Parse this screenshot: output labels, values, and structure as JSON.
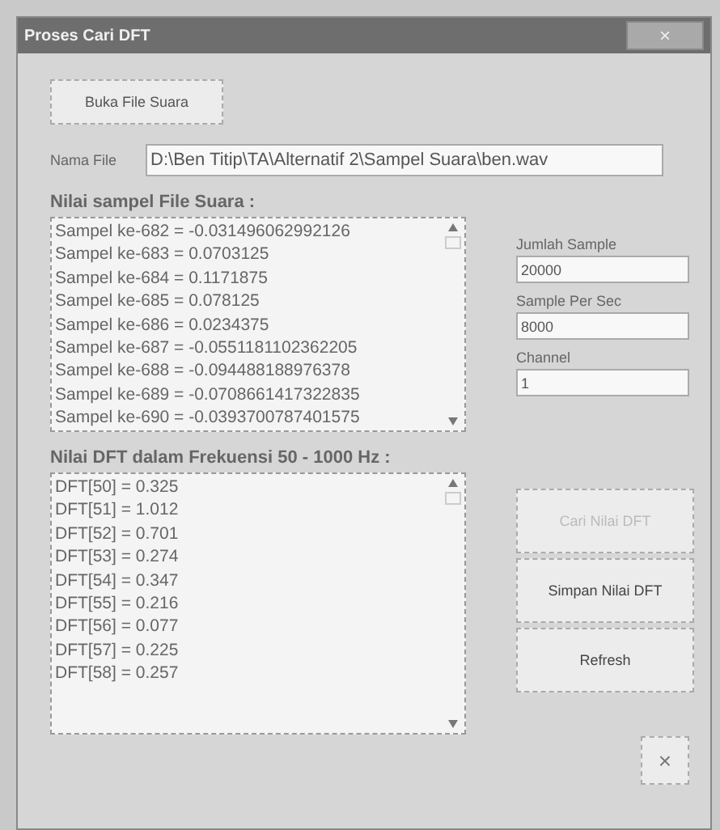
{
  "window": {
    "title": "Proses Cari DFT",
    "close": "×"
  },
  "open_button": {
    "label": "Buka File Suara"
  },
  "file_name": {
    "label": "Nama File",
    "value": "D:\\Ben Titip\\TA\\Alternatif 2\\Sampel Suara\\ben.wav"
  },
  "samples": {
    "heading": "Nilai sampel File Suara :",
    "items": [
      "Sampel ke-682 = -0.031496062992126",
      "Sampel ke-683 = 0.0703125",
      "Sampel ke-684 = 0.1171875",
      "Sampel ke-685 = 0.078125",
      "Sampel ke-686 = 0.0234375",
      "Sampel ke-687 = -0.0551181102362205",
      "Sampel ke-688 = -0.094488188976378",
      "Sampel ke-689 = -0.0708661417322835",
      "Sampel ke-690 = -0.0393700787401575"
    ]
  },
  "info_fields": [
    {
      "label": "Jumlah Sample",
      "value": "20000"
    },
    {
      "label": "Sample Per Sec",
      "value": "8000"
    },
    {
      "label": "Channel",
      "value": "1"
    }
  ],
  "dft": {
    "heading": "Nilai DFT dalam Frekuensi 50 - 1000 Hz :",
    "items": [
      "DFT[50] = 0.325",
      "DFT[51] = 1.012",
      "DFT[52] = 0.701",
      "DFT[53] = 0.274",
      "DFT[54] = 0.347",
      "DFT[55] = 0.216",
      "DFT[56] = 0.077",
      "DFT[57] = 0.225",
      "DFT[58] = 0.257"
    ]
  },
  "action_buttons": [
    {
      "label": "Cari Nilai DFT",
      "disabled": true
    },
    {
      "label": "Simpan Nilai DFT",
      "disabled": false
    },
    {
      "label": "Refresh",
      "disabled": false
    }
  ],
  "exit_button": {
    "label": "×"
  }
}
